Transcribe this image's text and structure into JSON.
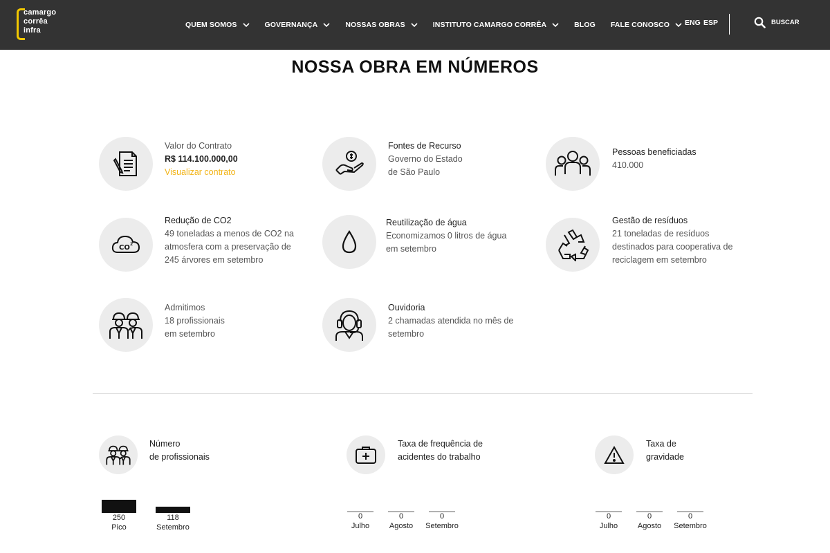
{
  "header": {
    "logo_lines": [
      "camargo",
      "corrêa",
      "infra"
    ],
    "nav": [
      "QUEM SOMOS",
      "GOVERNANÇA",
      "NOSSAS OBRAS",
      "INSTITUTO CAMARGO CORRÊA",
      "BLOG",
      "FALE CONOSCO"
    ],
    "lang_eng": "ENG",
    "lang_esp": "ESP",
    "search_label": "BUSCAR"
  },
  "page_title": "NOSSA OBRA EM NÚMEROS",
  "stats": {
    "contract": {
      "line1": "Valor do Contrato",
      "line2": "R$ 114.100.000,00",
      "link": "Visualizar contrato"
    },
    "funding": {
      "title": "Fontes de Recurso",
      "line1": "Governo do Estado",
      "line2": "de São Paulo"
    },
    "people": {
      "title": "Pessoas beneficiadas",
      "value": "410.000"
    },
    "co2": {
      "title": "Redução de CO2",
      "line1": "49 toneladas a menos de CO2 na",
      "line2": "atmosfera com a preservação de",
      "line3": "245 árvores em setembro"
    },
    "water": {
      "title": "Reutilização de água",
      "line1": "Economizamos 0 litros de água",
      "line2": "em setembro"
    },
    "waste": {
      "title": "Gestão de resíduos",
      "line1": " 21 toneladas de resíduos",
      "line2": "destinados para cooperativa de",
      "line3": "reciclagem em setembro"
    },
    "hired": {
      "line1": "Admitimos",
      "line2": "18 profissionais",
      "line3": "em setembro"
    },
    "ombudsman": {
      "title": "Ouvidoria",
      "line1": "2 chamadas atendida no mês de",
      "line2": "setembro"
    }
  },
  "indicators": {
    "professionals": {
      "line1": "Número",
      "line2": "de profissionais"
    },
    "frequency": {
      "line1": "Taxa de frequência de",
      "line2": "acidentes do trabalho"
    },
    "severity": {
      "line1": "Taxa de",
      "line2": "gravidade"
    }
  },
  "chart_data": [
    {
      "type": "bar",
      "categories": [
        "Pico",
        "Setembro"
      ],
      "values": [
        250,
        118
      ],
      "value_labels": [
        "250",
        "118"
      ]
    },
    {
      "type": "bar",
      "categories": [
        "Julho",
        "Agosto",
        "Setembro"
      ],
      "values": [
        0,
        0,
        0
      ],
      "value_labels": [
        "0",
        "0",
        "0"
      ]
    },
    {
      "type": "bar",
      "categories": [
        "Julho",
        "Agosto",
        "Setembro"
      ],
      "values": [
        0,
        0,
        0
      ],
      "value_labels": [
        "0",
        "0",
        "0"
      ]
    }
  ]
}
